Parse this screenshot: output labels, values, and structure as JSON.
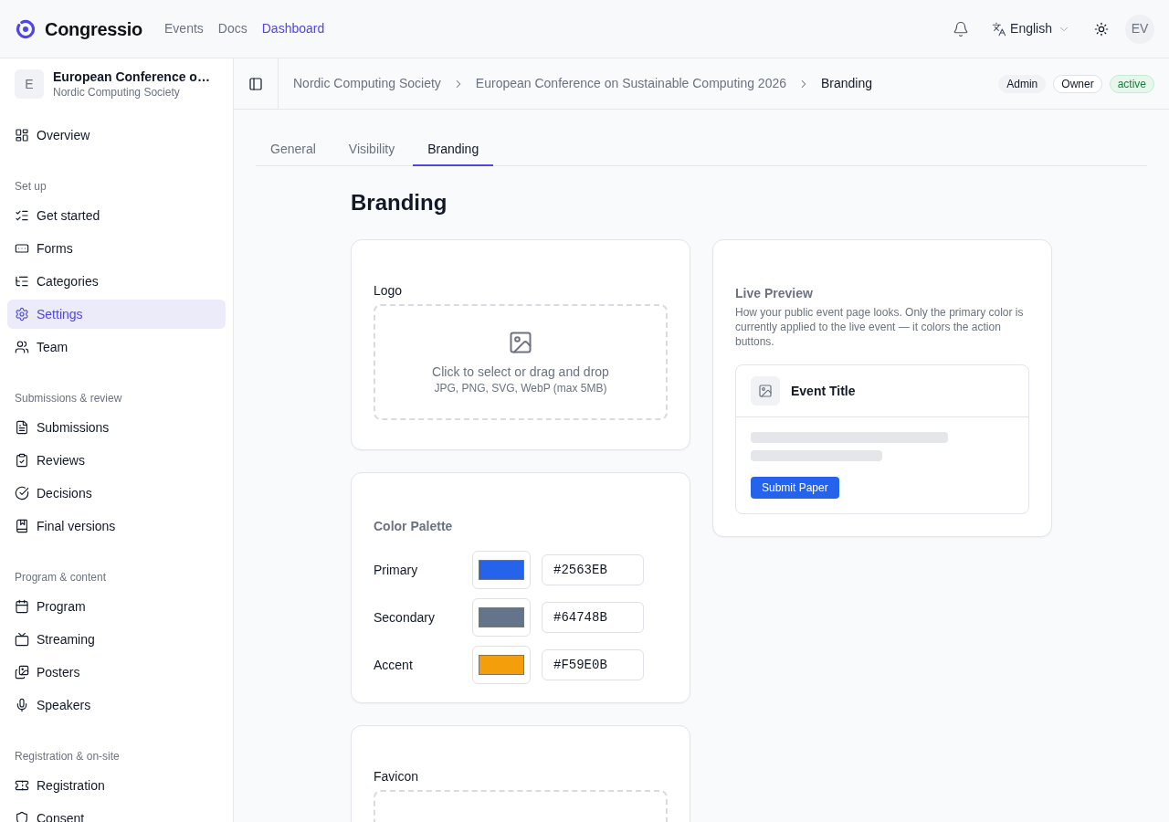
{
  "header": {
    "brand": "Congressio",
    "nav": [
      {
        "label": "Events",
        "selected": false
      },
      {
        "label": "Docs",
        "selected": false
      },
      {
        "label": "Dashboard",
        "selected": true
      }
    ],
    "language": "English",
    "avatar": "EV"
  },
  "sidebar": {
    "event": {
      "initial": "E",
      "title": "European Conference o…",
      "subtitle": "Nordic Computing Society"
    },
    "sections": [
      {
        "items": [
          {
            "label": "Overview",
            "selected": false
          }
        ]
      },
      {
        "heading": "Set up",
        "items": [
          {
            "label": "Get started",
            "selected": false
          },
          {
            "label": "Forms",
            "selected": false
          },
          {
            "label": "Categories",
            "selected": false
          },
          {
            "label": "Settings",
            "selected": true
          },
          {
            "label": "Team",
            "selected": false
          }
        ]
      },
      {
        "heading": "Submissions & review",
        "items": [
          {
            "label": "Submissions",
            "selected": false
          },
          {
            "label": "Reviews",
            "selected": false
          },
          {
            "label": "Decisions",
            "selected": false
          },
          {
            "label": "Final versions",
            "selected": false
          }
        ]
      },
      {
        "heading": "Program & content",
        "items": [
          {
            "label": "Program",
            "selected": false
          },
          {
            "label": "Streaming",
            "selected": false
          },
          {
            "label": "Posters",
            "selected": false
          },
          {
            "label": "Speakers",
            "selected": false
          }
        ]
      },
      {
        "heading": "Registration & on-site",
        "items": [
          {
            "label": "Registration",
            "selected": false
          },
          {
            "label": "Consent",
            "selected": false
          }
        ]
      }
    ]
  },
  "breadcrumb": {
    "items": [
      "Nordic Computing Society",
      "European Conference on Sustainable Computing 2026",
      "Branding"
    ],
    "badges": [
      {
        "label": "Admin",
        "kind": "neutral"
      },
      {
        "label": "Owner",
        "kind": "outline"
      },
      {
        "label": "active",
        "kind": "success"
      }
    ]
  },
  "tabs": [
    {
      "label": "General",
      "selected": false
    },
    {
      "label": "Visibility",
      "selected": false
    },
    {
      "label": "Branding",
      "selected": true
    }
  ],
  "page_title": "Branding",
  "logo": {
    "label": "Logo",
    "dropzone": {
      "text": "Click to select or drag and drop",
      "hint": "JPG, PNG, SVG, WebP (max 5MB)"
    }
  },
  "color_palette": {
    "title": "Color Palette",
    "rows": [
      {
        "label": "Primary",
        "color": "#2563eb",
        "value": "#2563EB"
      },
      {
        "label": "Secondary",
        "color": "#64748b",
        "value": "#64748B"
      },
      {
        "label": "Accent",
        "color": "#f59e0b",
        "value": "#F59E0B"
      }
    ]
  },
  "favicon": {
    "label": "Favicon"
  },
  "live_preview": {
    "title": "Live Preview",
    "description": "How your public event page looks. Only the primary color is currently applied to the live event — it colors the action buttons.",
    "event_title": "Event Title",
    "button": "Submit Paper"
  }
}
